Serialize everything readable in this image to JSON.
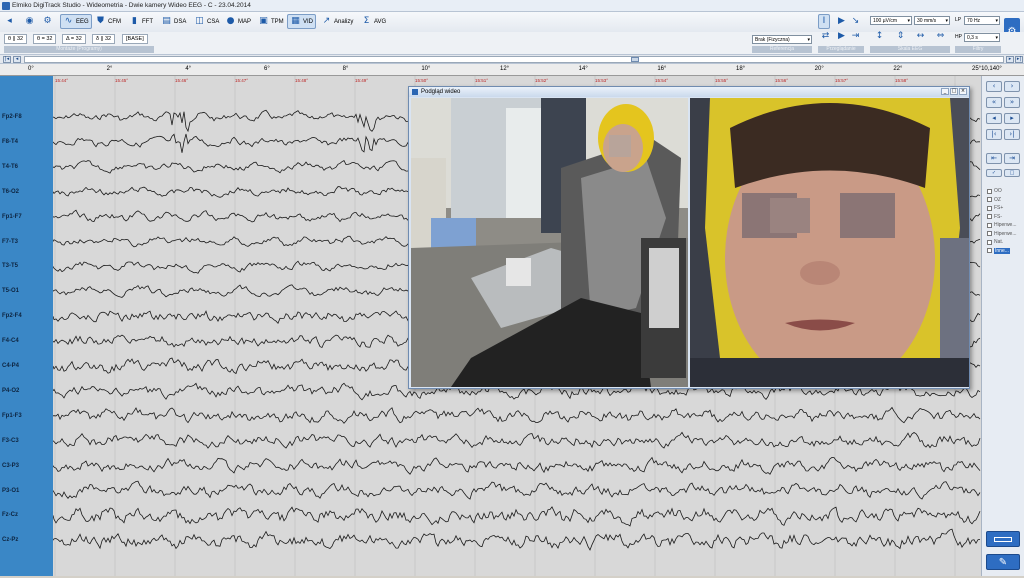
{
  "window": {
    "title": "Elmiko DigiTrack Studio  -  Wideometria  -  Dwie kamery Wideo EEG  -  C  -  23.04.2014"
  },
  "toolbar": {
    "items": [
      {
        "label": "",
        "icon": "chevron-left-icon"
      },
      {
        "label": "",
        "icon": "eye-icon"
      },
      {
        "label": "",
        "icon": "gear-icon"
      },
      {
        "label": "EEG",
        "icon": "eeg-wave-icon",
        "active": true
      },
      {
        "label": "CFM",
        "icon": "shield-icon"
      },
      {
        "label": "FFT",
        "icon": "bars-icon"
      },
      {
        "label": "DSA",
        "icon": "spectrum-icon"
      },
      {
        "label": "CSA",
        "icon": "stack-icon"
      },
      {
        "label": "MAP",
        "icon": "head-map-icon"
      },
      {
        "label": "TPM",
        "icon": "topo-icon"
      },
      {
        "label": "VID",
        "icon": "video-icon",
        "active": true
      },
      {
        "label": "Analizy",
        "icon": "chart-line-icon"
      },
      {
        "label": "AVG",
        "icon": "sigma-icon"
      }
    ]
  },
  "bands": {
    "tabs": [
      "θ || 32",
      "θ = 32",
      "Δ = 32",
      "δ || 32",
      "[BASE]"
    ],
    "group_label": "Montaże (Programy)"
  },
  "controls": {
    "reference_value": "Brak (Fizyczna)",
    "reference_label": "Referencja",
    "tools_label": "Przeglądanie",
    "scale_label": "Skala EEG",
    "amplitude": "100 µV/cm",
    "speed": "30 mm/s",
    "lp_label": "LP",
    "lp_value": "70 Hz",
    "hp_label": "HP",
    "hp_value": "0,3 s",
    "filters_label": "Filtry"
  },
  "ruler": {
    "ticks": [
      "0°",
      "2°",
      "4°",
      "6°",
      "8°",
      "10°",
      "12°",
      "14°",
      "16°",
      "18°",
      "20°",
      "22°",
      "25°10,140°"
    ],
    "times": [
      "15:44°",
      "15:45°",
      "15:46°",
      "15:47°",
      "15:48°",
      "15:49°",
      "15:50°",
      "15:51°",
      "15:52°",
      "15:53°",
      "15:54°",
      "15:55°",
      "15:56°",
      "15:57°",
      "15:58°"
    ]
  },
  "channels": [
    "Fp2-F8",
    "F8-T4",
    "T4-T6",
    "T6-O2",
    "Fp1-F7",
    "F7-T3",
    "T3-T5",
    "T5-O1",
    "Fp2-F4",
    "F4-C4",
    "C4-P4",
    "P4-O2",
    "Fp1-F3",
    "F3-C3",
    "C3-P3",
    "P3-O1",
    "Fz-Cz",
    "Cz-Pz"
  ],
  "video": {
    "title": "Podgląd wideo",
    "cameras": [
      {
        "name": "camera-room"
      },
      {
        "name": "camera-face"
      }
    ]
  },
  "events": [
    "OO",
    "OZ",
    "FS+",
    "FS-",
    "Hiperwe...",
    "Hiperwe...",
    "Nat.",
    "Inne..."
  ],
  "colors": {
    "channel_panel": "#3a87c6",
    "trace": "#1a1a1a",
    "accent": "#1d5aa8",
    "time_marker": "#b22222",
    "hat": "#e4c51e"
  }
}
